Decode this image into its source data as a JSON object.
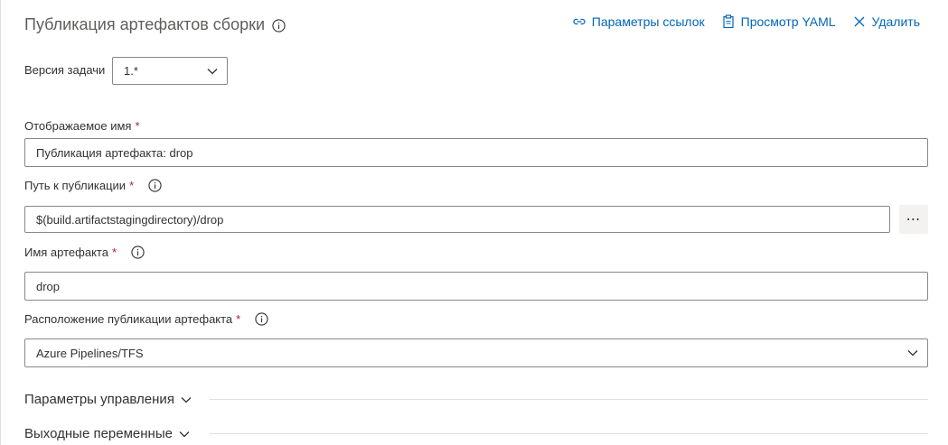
{
  "header": {
    "title": "Публикация артефактов сборки",
    "title_icon": "info-icon"
  },
  "toolbar": {
    "link_settings_label": "Параметры ссылок",
    "link_settings_icon": "link-icon",
    "view_yaml_label": "Просмотр YAML",
    "view_yaml_icon": "clipboard-icon",
    "remove_label": "Удалить",
    "remove_icon": "close-icon"
  },
  "task_version": {
    "label": "Версия задачи",
    "value": "1.*"
  },
  "display_name": {
    "label": "Отображаемое имя",
    "required": "*",
    "value": "Публикация артефакта: drop"
  },
  "path_to_publish": {
    "label": "Путь к публикации",
    "required": "*",
    "value": "$(build.artifactstagingdirectory)/drop",
    "browse_label": "⋯"
  },
  "artifact_name": {
    "label": "Имя артефакта",
    "required": "*",
    "value": "drop"
  },
  "publish_location": {
    "label": "Расположение публикации артефакта",
    "required": "*",
    "value": "Azure Pipelines/TFS"
  },
  "sections": {
    "control_options": "Параметры управления",
    "output_variables": "Выходные переменные"
  },
  "colors": {
    "accent": "#0066b8",
    "required": "#a4262c",
    "border": "#8a8886",
    "divider": "#e1dfdd"
  }
}
